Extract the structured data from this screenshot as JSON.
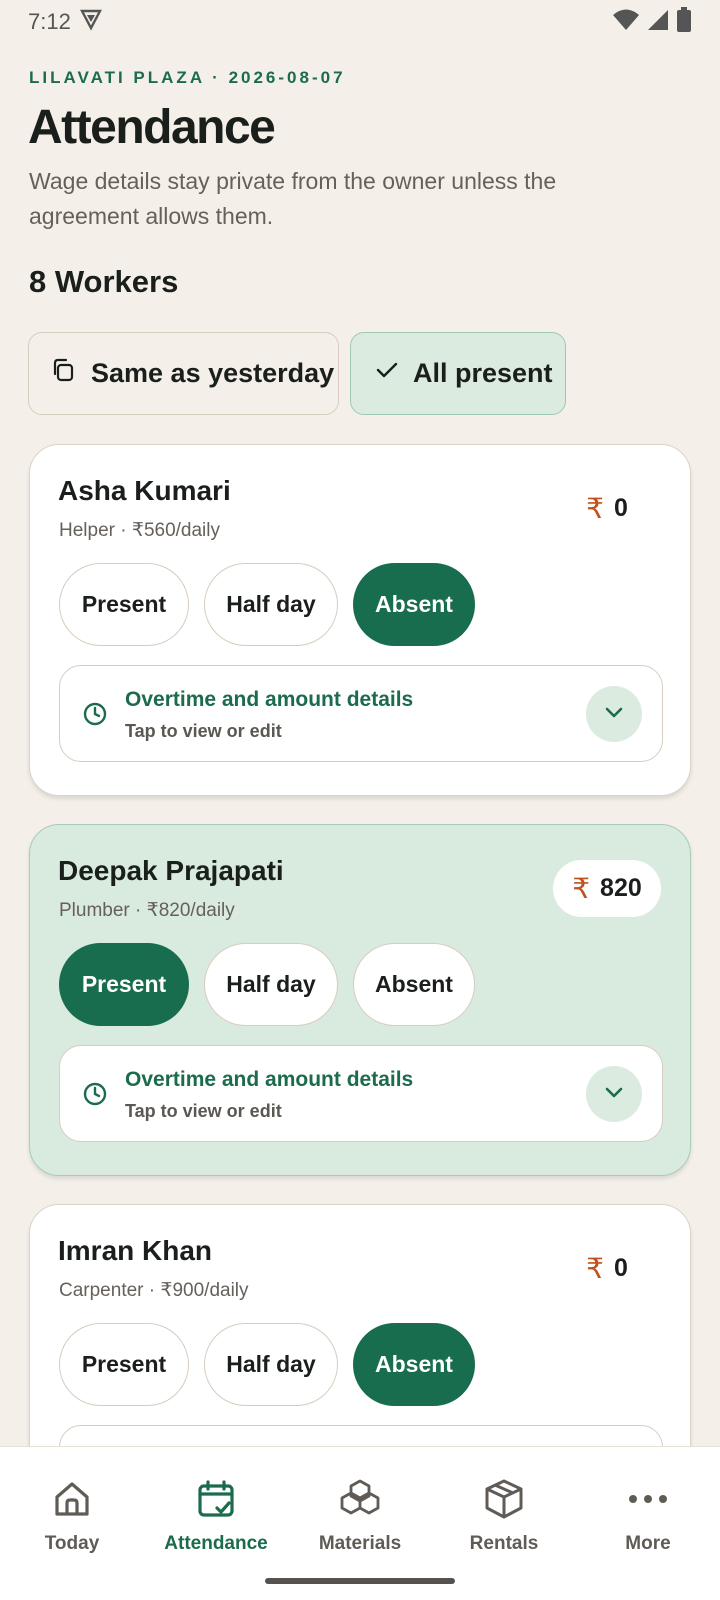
{
  "status_bar": {
    "time": "7:12"
  },
  "header": {
    "overline": "LILAVATI PLAZA · 2026-08-07",
    "title": "Attendance",
    "subtitle": "Wage details stay private from the owner unless the agreement allows them.",
    "workers_count": "8 Workers"
  },
  "quick_actions": {
    "same_as_yesterday": "Same as yesterday",
    "all_present": "All present"
  },
  "status_options": [
    "Present",
    "Half day",
    "Absent"
  ],
  "details": {
    "title": "Overtime and amount details",
    "hint": "Tap to view or edit"
  },
  "currency_symbol": "₹",
  "workers": [
    {
      "name": "Asha Kumari",
      "role": "Helper · ₹560/daily",
      "amount": "0",
      "status": "Absent"
    },
    {
      "name": "Deepak Prajapati",
      "role": "Plumber · ₹820/daily",
      "amount": "820",
      "status": "Present"
    },
    {
      "name": "Imran Khan",
      "role": "Carpenter · ₹900/daily",
      "amount": "0",
      "status": "Absent"
    }
  ],
  "bottom_nav": [
    {
      "label": "Today",
      "icon": "home-icon",
      "active": false
    },
    {
      "label": "Attendance",
      "icon": "calendar-check-icon",
      "active": true
    },
    {
      "label": "Materials",
      "icon": "boxes-icon",
      "active": false
    },
    {
      "label": "Rentals",
      "icon": "package-icon",
      "active": false
    },
    {
      "label": "More",
      "icon": "more-dots-icon",
      "active": false
    }
  ],
  "colors": {
    "accent": "#186d4e",
    "background": "#f4f0e9",
    "active_card": "#d9ebdf",
    "rupee": "#c0501c"
  }
}
